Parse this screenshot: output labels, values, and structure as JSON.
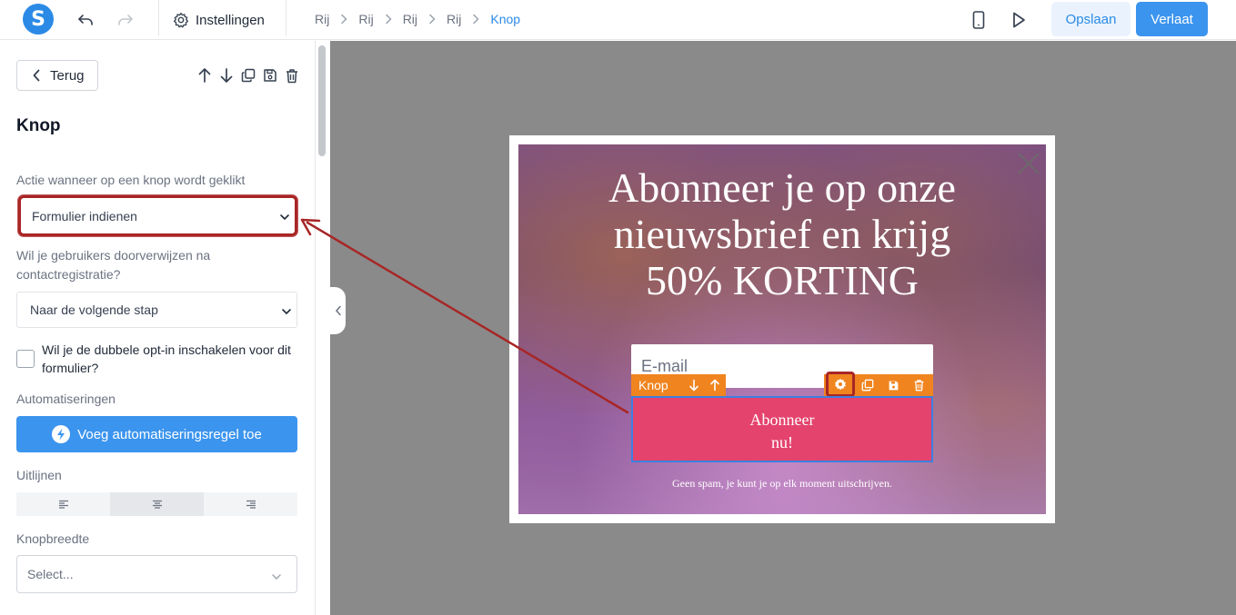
{
  "topbar": {
    "logo_letter": "S",
    "settings_label": "Instellingen",
    "breadcrumbs": [
      {
        "label": "Rij"
      },
      {
        "label": "Rij"
      },
      {
        "label": "Rij"
      },
      {
        "label": "Rij"
      },
      {
        "label": "Knop"
      }
    ],
    "save_label": "Opslaan",
    "leave_label": "Verlaat",
    "icons": [
      "undo-icon",
      "redo-icon",
      "gear-icon",
      "mobile-icon",
      "play-icon"
    ]
  },
  "sidebar": {
    "back_label": "Terug",
    "title": "Knop",
    "action_label": "Actie wanneer op een knop wordt geklikt",
    "action_value": "Formulier indienen",
    "redirect_label": "Wil je gebruikers doorverwijzen na contactregistratie?",
    "redirect_value": "Naar de volgende stap",
    "double_optin_label": "Wil je de dubbele opt-in inschakelen voor dit formulier?",
    "automations_label": "Automatiseringen",
    "automation_button": "Voeg automatiseringsregel toe",
    "align_label": "Uitlijnen",
    "align_active": "center",
    "button_width_label": "Knopbreedte",
    "button_width_placeholder": "Select..."
  },
  "popup": {
    "title_line1": "Abonneer je op onze",
    "title_line2": "nieuwsbrief en krijg",
    "title_line3": "50% KORTING",
    "email_placeholder": "E-mail",
    "toolbar_label": "Knop",
    "cta_line1": "Abonneer",
    "cta_line2": "nu!",
    "disclaimer": "Geen spam, je kunt je op elk moment uitschrijven."
  },
  "colors": {
    "accent": "#2b8ae6",
    "primary_button": "#3b94ee",
    "highlight": "#a82626",
    "element_toolbar": "#f0841f",
    "cta": "#e4436d",
    "canvas": "#8a8a8a"
  }
}
